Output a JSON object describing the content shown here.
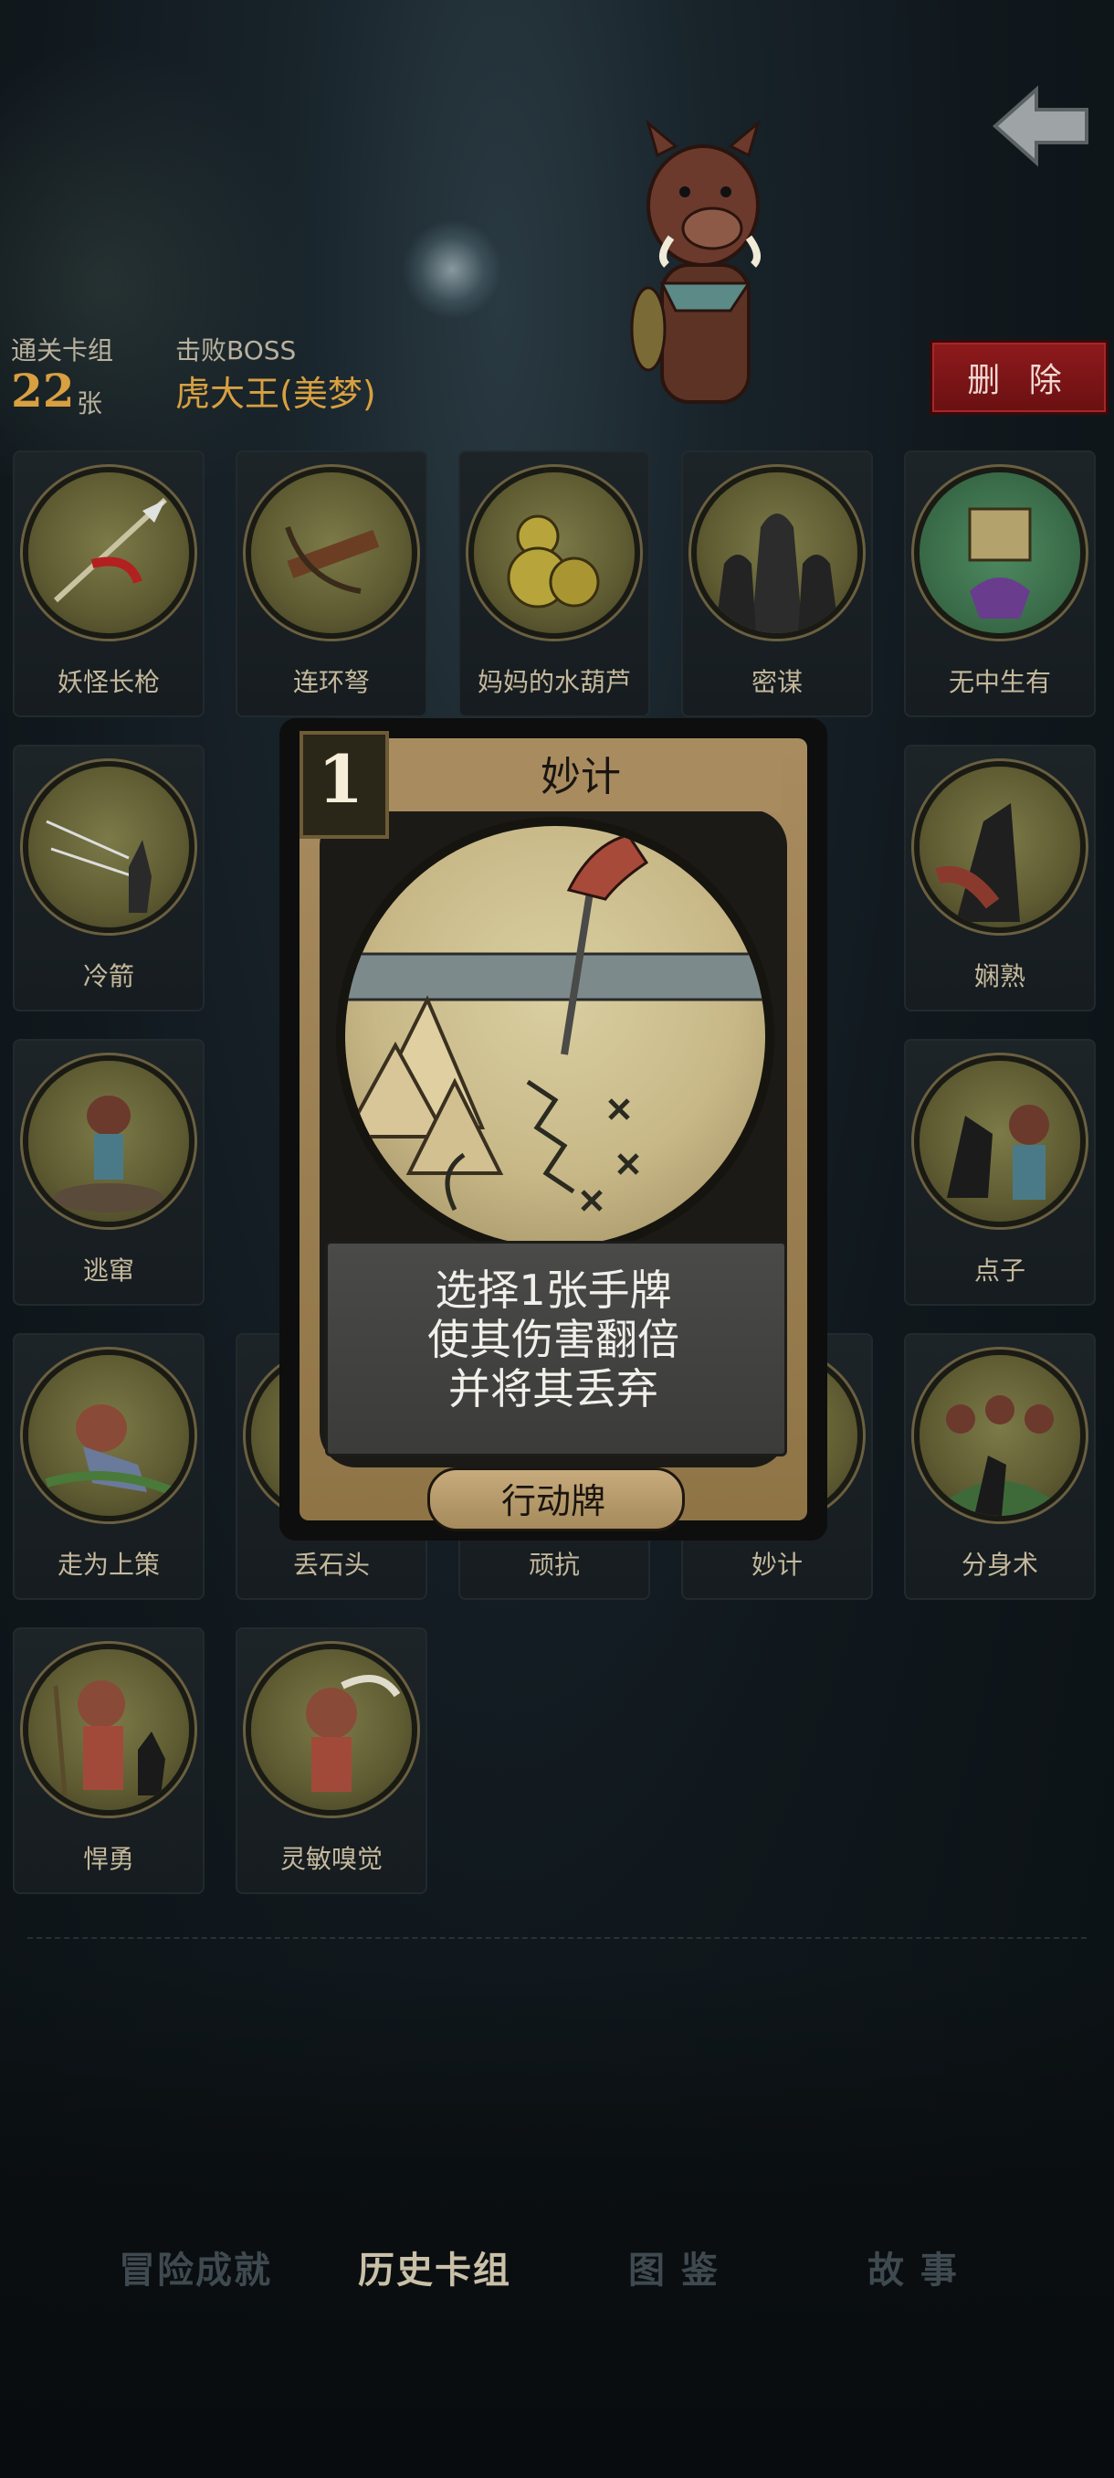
{
  "header": {
    "deck_label": "通关卡组",
    "deck_count": "22",
    "deck_unit": "张",
    "boss_label": "击败BOSS",
    "boss_name": "虎大王(美梦)",
    "delete_label": "删 除"
  },
  "cards": [
    {
      "name": "妖怪长枪"
    },
    {
      "name": "连环弩"
    },
    {
      "name": "妈妈的水葫芦"
    },
    {
      "name": "密谋"
    },
    {
      "name": "无中生有"
    },
    {
      "name": "冷箭"
    },
    {
      "name": "娴熟"
    },
    {
      "name": "逃窜"
    },
    {
      "name": "点子"
    },
    {
      "name": "走为上策"
    },
    {
      "name": "丢石头"
    },
    {
      "name": "顽抗"
    },
    {
      "name": "妙计"
    },
    {
      "name": "分身术"
    },
    {
      "name": "悍勇"
    },
    {
      "name": "灵敏嗅觉"
    }
  ],
  "popup": {
    "cost": "1",
    "title": "妙计",
    "desc_lines": [
      "选择1张手牌",
      "使其伤害翻倍",
      "并将其丢弃"
    ],
    "type": "行动牌"
  },
  "tabs": [
    {
      "label": "冒险成就",
      "active": false
    },
    {
      "label": "历史卡组",
      "active": true
    },
    {
      "label": "图  鉴",
      "active": false
    },
    {
      "label": "故  事",
      "active": false
    }
  ],
  "colors": {
    "accent_gold": "#d8a040",
    "delete_red": "#8e1a1c",
    "parchment": "#a88c60"
  }
}
